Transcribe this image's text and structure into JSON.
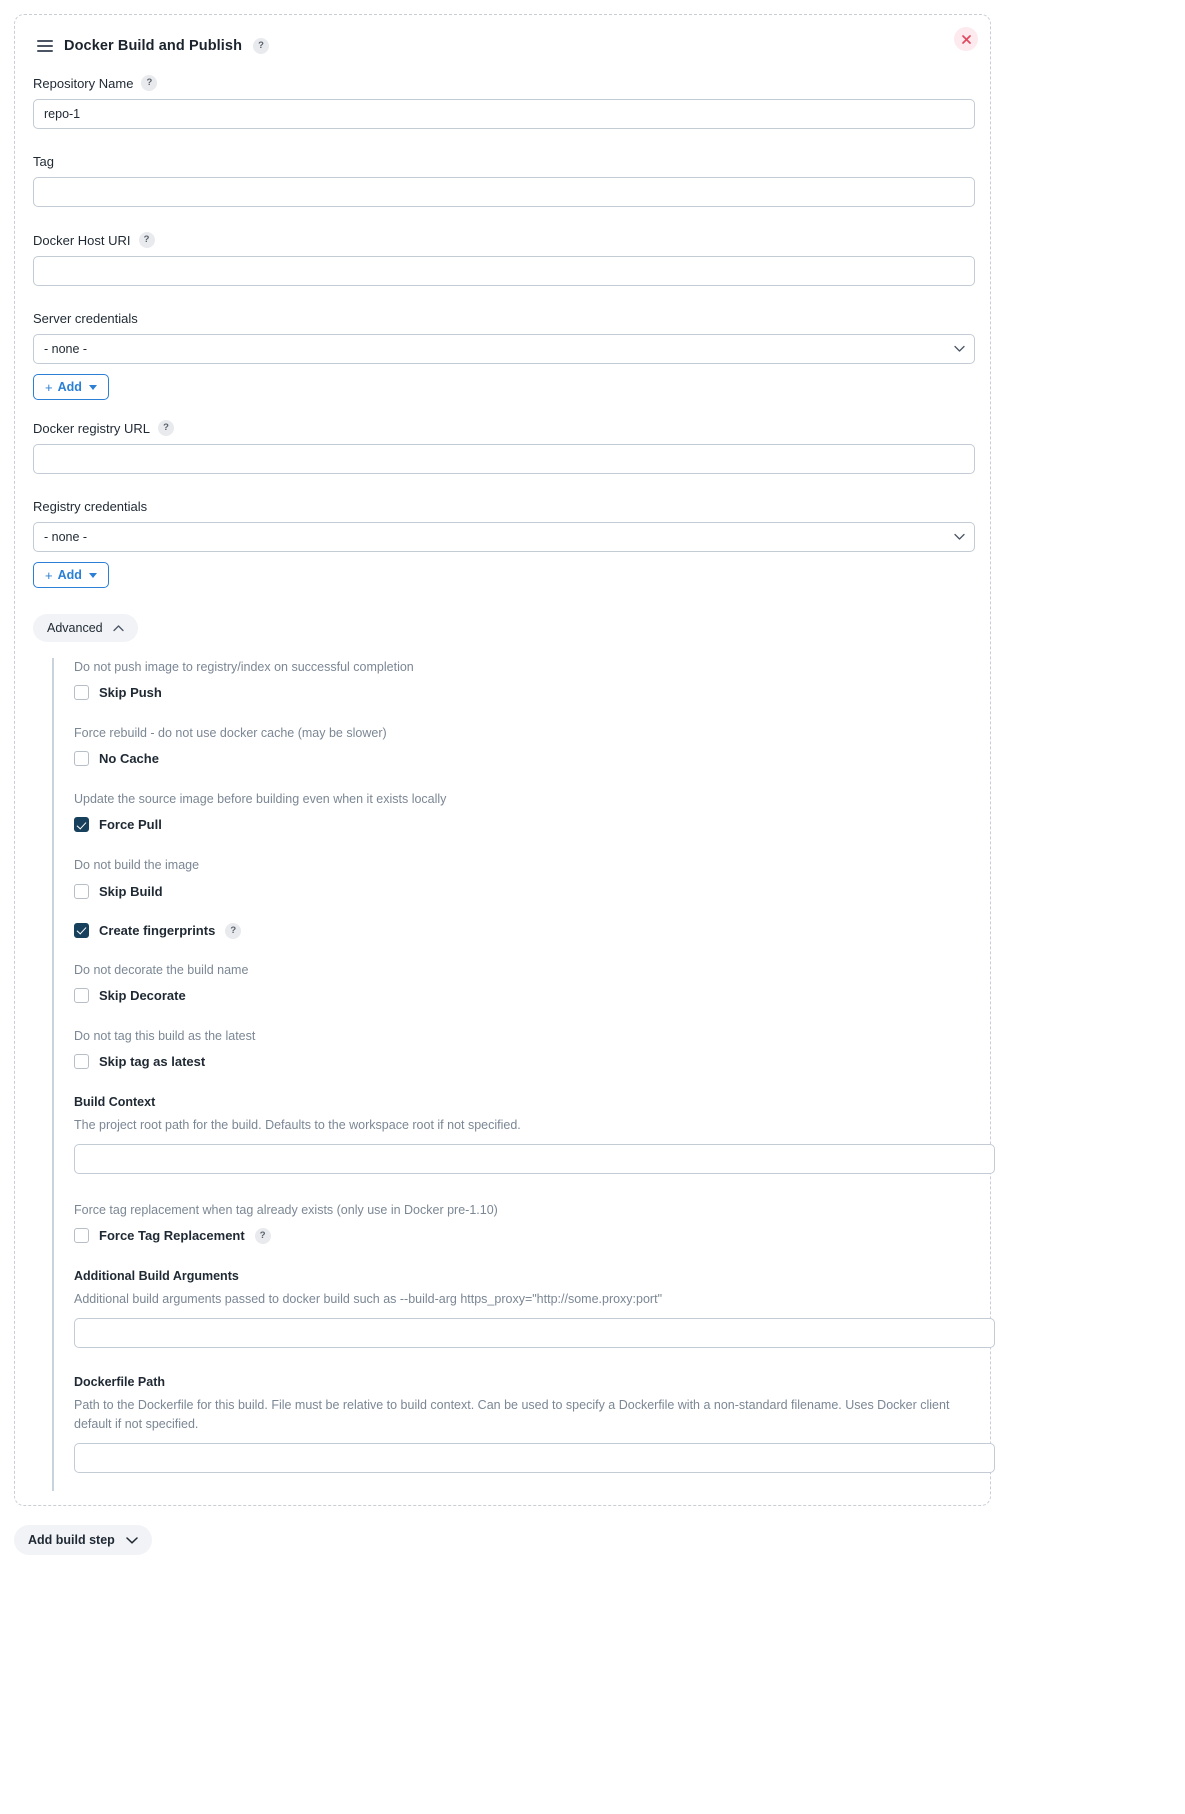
{
  "step": {
    "title": "Docker Build and Publish",
    "help_glyph": "?",
    "drag_handle_name": "drag-handle",
    "close_label": "✕"
  },
  "fields": {
    "repository_name": {
      "label": "Repository Name",
      "value": "repo-1",
      "placeholder": "",
      "help": "?"
    },
    "tag": {
      "label": "Tag",
      "value": "",
      "placeholder": ""
    },
    "docker_host_uri": {
      "label": "Docker Host URI",
      "value": "",
      "placeholder": "",
      "help": "?"
    },
    "server_credentials": {
      "label": "Server credentials",
      "value": "- none -",
      "options": [
        "- none -"
      ],
      "add_label": "Add",
      "add_plus": "+"
    },
    "docker_registry_url": {
      "label": "Docker registry URL",
      "value": "",
      "placeholder": "",
      "help": "?"
    },
    "registry_credentials": {
      "label": "Registry credentials",
      "value": "- none -",
      "options": [
        "- none -"
      ],
      "add_label": "Add",
      "add_plus": "+"
    }
  },
  "advanced": {
    "toggle_label": "Advanced",
    "expanded": true,
    "groups": [
      {
        "desc": "Do not push image to registry/index on successful completion",
        "label": "Skip Push",
        "checked": false
      },
      {
        "desc": "Force rebuild - do not use docker cache (may be slower)",
        "label": "No Cache",
        "checked": false
      },
      {
        "desc": "Update the source image before building even when it exists locally",
        "label": "Force Pull",
        "checked": true
      },
      {
        "desc": "Do not build the image",
        "label": "Skip Build",
        "checked": false
      },
      {
        "desc": "",
        "label": "Create fingerprints",
        "checked": true,
        "help": "?"
      },
      {
        "desc": "Do not decorate the build name",
        "label": "Skip Decorate",
        "checked": false
      },
      {
        "desc": "Do not tag this build as the latest",
        "label": "Skip tag as latest",
        "checked": false
      }
    ],
    "build_context": {
      "label": "Build Context",
      "desc": "The project root path for the build. Defaults to the workspace root if not specified.",
      "value": "",
      "placeholder": ""
    },
    "force_tag_replacement": {
      "desc": "Force tag replacement when tag already exists (only use in Docker pre-1.10)",
      "label": "Force Tag Replacement",
      "checked": false,
      "help": "?"
    },
    "additional_build_arguments": {
      "label": "Additional Build Arguments",
      "desc": "Additional build arguments passed to docker build such as --build-arg https_proxy=\"http://some.proxy:port\"",
      "value": "",
      "placeholder": ""
    },
    "dockerfile_path": {
      "label": "Dockerfile Path",
      "desc": "Path to the Dockerfile for this build. File must be relative to build context. Can be used to specify a Dockerfile with a non-standard filename. Uses Docker client default if not specified.",
      "value": "",
      "placeholder": ""
    }
  },
  "footer": {
    "add_build_step_label": "Add build step"
  },
  "colors": {
    "accent_blue": "#2b7fd4",
    "checkbox_checked": "#17405c",
    "close_red": "#e0485f",
    "close_bg": "#fdeaee",
    "muted_text": "#7b8794",
    "border": "#c3cbd4"
  }
}
